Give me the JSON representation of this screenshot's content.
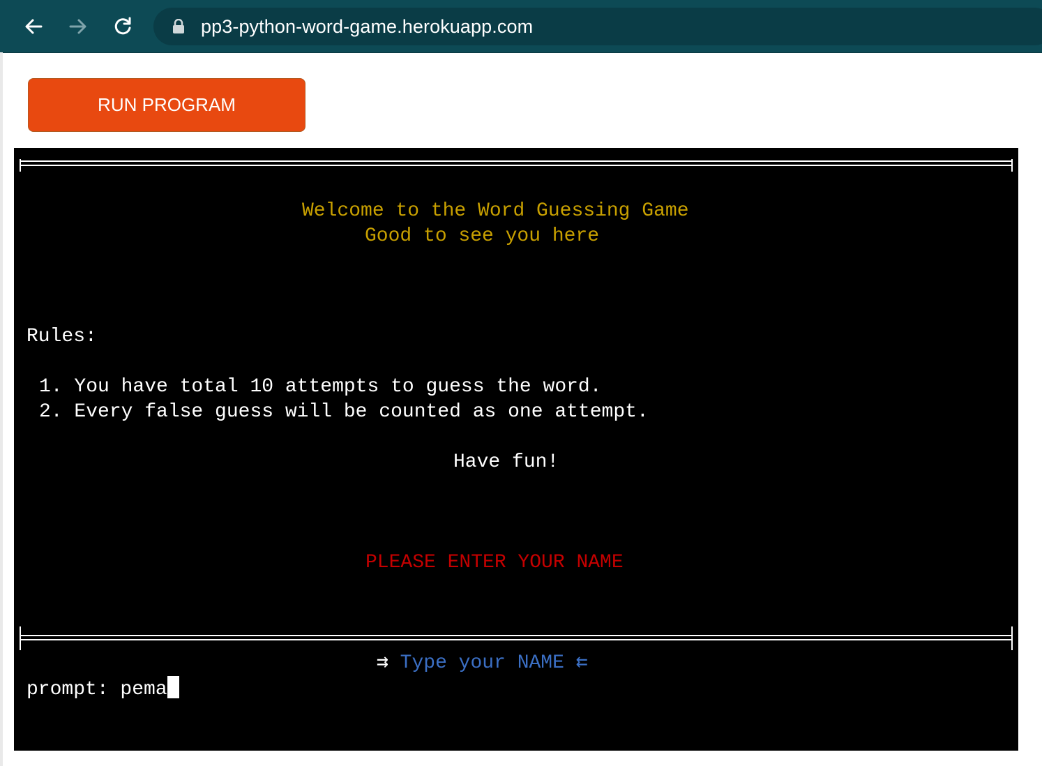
{
  "browser": {
    "url": "pp3-python-word-game.herokuapp.com"
  },
  "page": {
    "run_button_label": "RUN PROGRAM"
  },
  "terminal": {
    "welcome_line": "Welcome to the Word Guessing Game",
    "greeting_line": "Good to see you here",
    "rules_heading": "Rules:",
    "rules": [
      "1. You have total 10 attempts to guess the word.",
      "2. Every false guess will be counted as one attempt."
    ],
    "have_fun": "Have fun!",
    "enter_name_message": "PLEASE ENTER YOUR NAME",
    "type_name_hint": "Type your NAME",
    "hint_left_arrow": "⇉",
    "hint_right_arrow": "⇇",
    "prompt_label": "prompt: ",
    "prompt_value": "pema"
  },
  "colors": {
    "run_button": "#e84910",
    "title_text": "#c8a000",
    "warning_text": "#c40000",
    "hint_text": "#3b6fc4",
    "browser_bar": "#0d4a55"
  }
}
